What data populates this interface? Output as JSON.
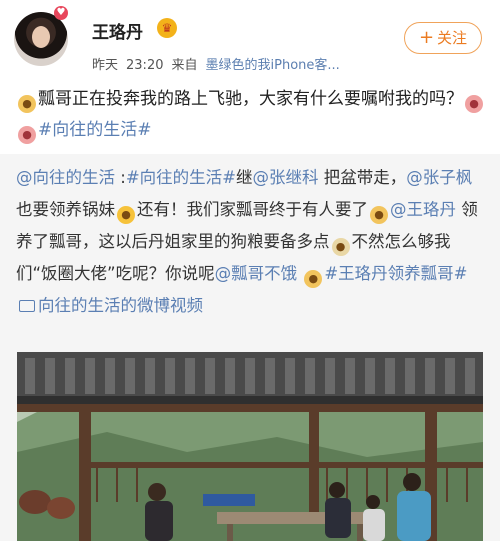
{
  "header": {
    "username": "王珞丹",
    "time_label": "昨天",
    "time": "23:20",
    "source_prefix": "来自",
    "source": "墨绿色的我iPhone客...",
    "follow_label": "关注",
    "follow_plus": "+"
  },
  "post": {
    "text_part1": "瓢哥正在投奔我的路上飞驰，大家有什么要嘱咐我的吗？",
    "hashtag": "#向往的生活#"
  },
  "repost": {
    "line1_mention": "@向往的生活",
    "line1_sep": " :",
    "line1_hashtag": "#向往的生活#",
    "line1_text": "继",
    "line1_mention2": "@张继科",
    "line1_text2": " 把盆带走，",
    "line2_mention": "@张子枫",
    "line2_text": " 也要领养锅妹",
    "line2_text2": "还有！我们家瓢哥终于有人要了",
    "line3_mention": "@王珞丹",
    "line3_text": " 领养了瓢哥，这以后丹姐家里的狗粮要备多点",
    "line4_text": "不然怎么够我们“饭圈大佬”吃呢？你说呢",
    "line4_mention": "@瓢哥不饿",
    "line5_hashtag": "#王珞丹领养瓢哥#",
    "video_text": "向往的生活的微博视频"
  },
  "icons": {
    "avatar_badge": "♥",
    "vip": "♛"
  },
  "colors": {
    "link": "#5b7fb3",
    "follow": "#eb7b21",
    "repost_bg": "#f5f5f5"
  }
}
